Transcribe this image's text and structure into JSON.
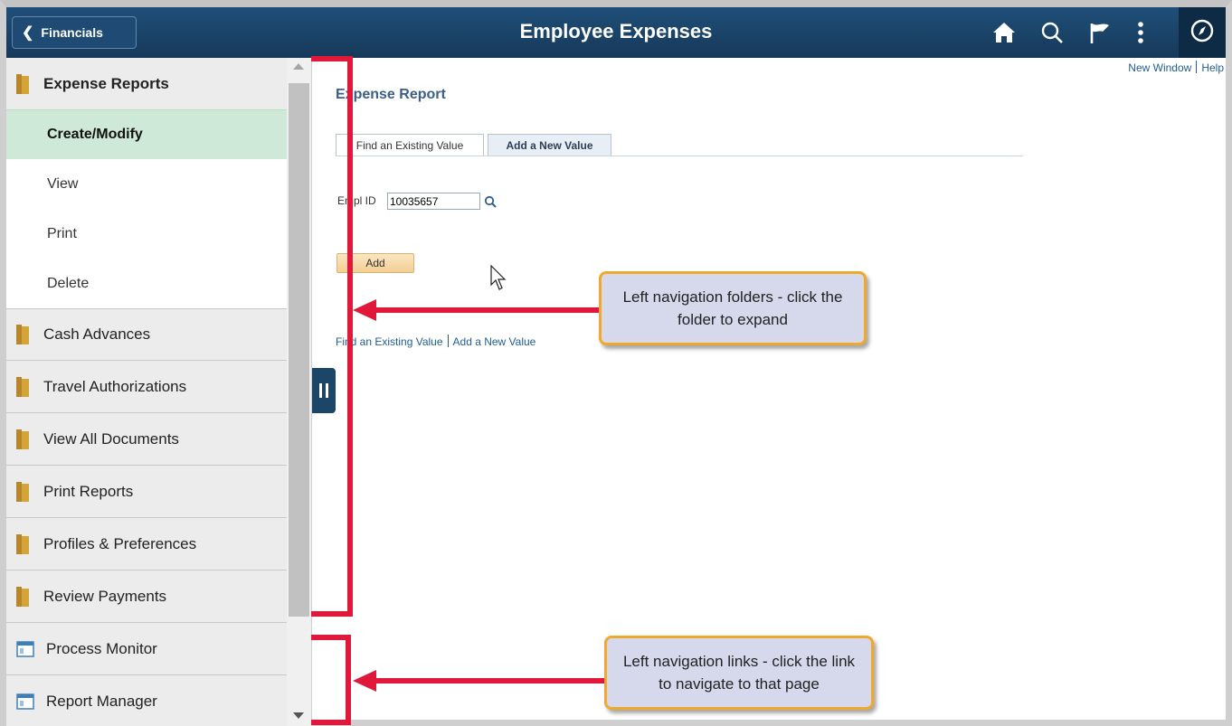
{
  "header": {
    "back_label": "Financials",
    "title": "Employee Expenses",
    "icons": [
      "home-icon",
      "search-icon",
      "flag-icon",
      "more-vertical-icon",
      "navbar-compass-icon"
    ]
  },
  "sidebar": {
    "folders": [
      {
        "label": "Expense Reports",
        "expanded": true
      },
      {
        "label": "Cash Advances"
      },
      {
        "label": "Travel Authorizations"
      },
      {
        "label": "View All Documents"
      },
      {
        "label": "Print Reports"
      },
      {
        "label": "Profiles & Preferences"
      },
      {
        "label": "Review Payments"
      }
    ],
    "expense_items": [
      {
        "label": "Create/Modify",
        "selected": true
      },
      {
        "label": "View"
      },
      {
        "label": "Print"
      },
      {
        "label": "Delete"
      }
    ],
    "links": [
      {
        "label": "Process Monitor"
      },
      {
        "label": "Report Manager"
      }
    ]
  },
  "content": {
    "new_window": "New Window",
    "help": "Help",
    "page_title": "Expense Report",
    "tabs": [
      {
        "label": "Find an Existing Value"
      },
      {
        "label": "Add a New Value",
        "active": true
      }
    ],
    "empl_id_label": "Empl ID",
    "empl_id_value": "10035657",
    "add_button": "Add",
    "bottom_links": [
      "Find an Existing Value",
      "Add a New Value"
    ]
  },
  "annotations": {
    "callout_folders": "Left navigation folders - click the folder to expand",
    "callout_links": "Left navigation links - click the link to navigate to that page"
  },
  "colors": {
    "header_bg": "#1a4266",
    "selected_item_bg": "#cfe9d8",
    "folder_icon": "#d4a437",
    "annotation_red": "#e0193b",
    "callout_border": "#f0a92a",
    "callout_bg": "#d6d8ec"
  }
}
